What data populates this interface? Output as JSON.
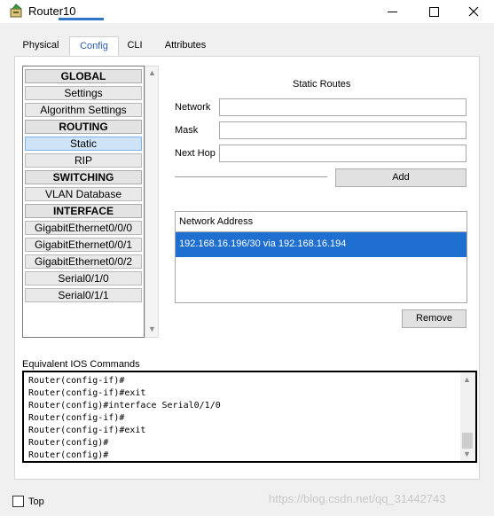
{
  "window": {
    "title": "Router10",
    "icons": {
      "app": "router-app-icon",
      "minimize": "minimize-icon",
      "maximize": "maximize-icon",
      "close": "close-icon"
    }
  },
  "tabs": [
    {
      "label": "Physical",
      "selected": false
    },
    {
      "label": "Config",
      "selected": true
    },
    {
      "label": "CLI",
      "selected": false
    },
    {
      "label": "Attributes",
      "selected": false
    }
  ],
  "nav": {
    "items": [
      {
        "label": "GLOBAL",
        "type": "header"
      },
      {
        "label": "Settings",
        "type": "item"
      },
      {
        "label": "Algorithm Settings",
        "type": "item"
      },
      {
        "label": "ROUTING",
        "type": "header"
      },
      {
        "label": "Static",
        "type": "item",
        "selected": true
      },
      {
        "label": "RIP",
        "type": "item"
      },
      {
        "label": "SWITCHING",
        "type": "header"
      },
      {
        "label": "VLAN Database",
        "type": "item"
      },
      {
        "label": "INTERFACE",
        "type": "header"
      },
      {
        "label": "GigabitEthernet0/0/0",
        "type": "item"
      },
      {
        "label": "GigabitEthernet0/0/1",
        "type": "item"
      },
      {
        "label": "GigabitEthernet0/0/2",
        "type": "item"
      },
      {
        "label": "Serial0/1/0",
        "type": "item"
      },
      {
        "label": "Serial0/1/1",
        "type": "item"
      }
    ]
  },
  "static_routes": {
    "title": "Static Routes",
    "network_label": "Network",
    "network_value": "",
    "mask_label": "Mask",
    "mask_value": "",
    "next_hop_label": "Next Hop",
    "next_hop_value": "",
    "add_label": "Add",
    "list_header": "Network Address",
    "routes": [
      "192.168.16.196/30 via 192.168.16.194"
    ],
    "remove_label": "Remove"
  },
  "ios": {
    "label": "Equivalent IOS Commands",
    "lines": [
      "Router(config-if)#",
      "Router(config-if)#exit",
      "Router(config)#interface Serial0/1/0",
      "Router(config-if)#",
      "Router(config-if)#exit",
      "Router(config)#",
      "Router(config)#"
    ]
  },
  "footer": {
    "top_label": "Top",
    "top_checked": false,
    "watermark": "https://blog.csdn.net/qq_31442743"
  },
  "colors": {
    "selection": "#1f6fd1",
    "tab_accent": "#2f77c4",
    "nav_selected": "#cfe3f7"
  }
}
